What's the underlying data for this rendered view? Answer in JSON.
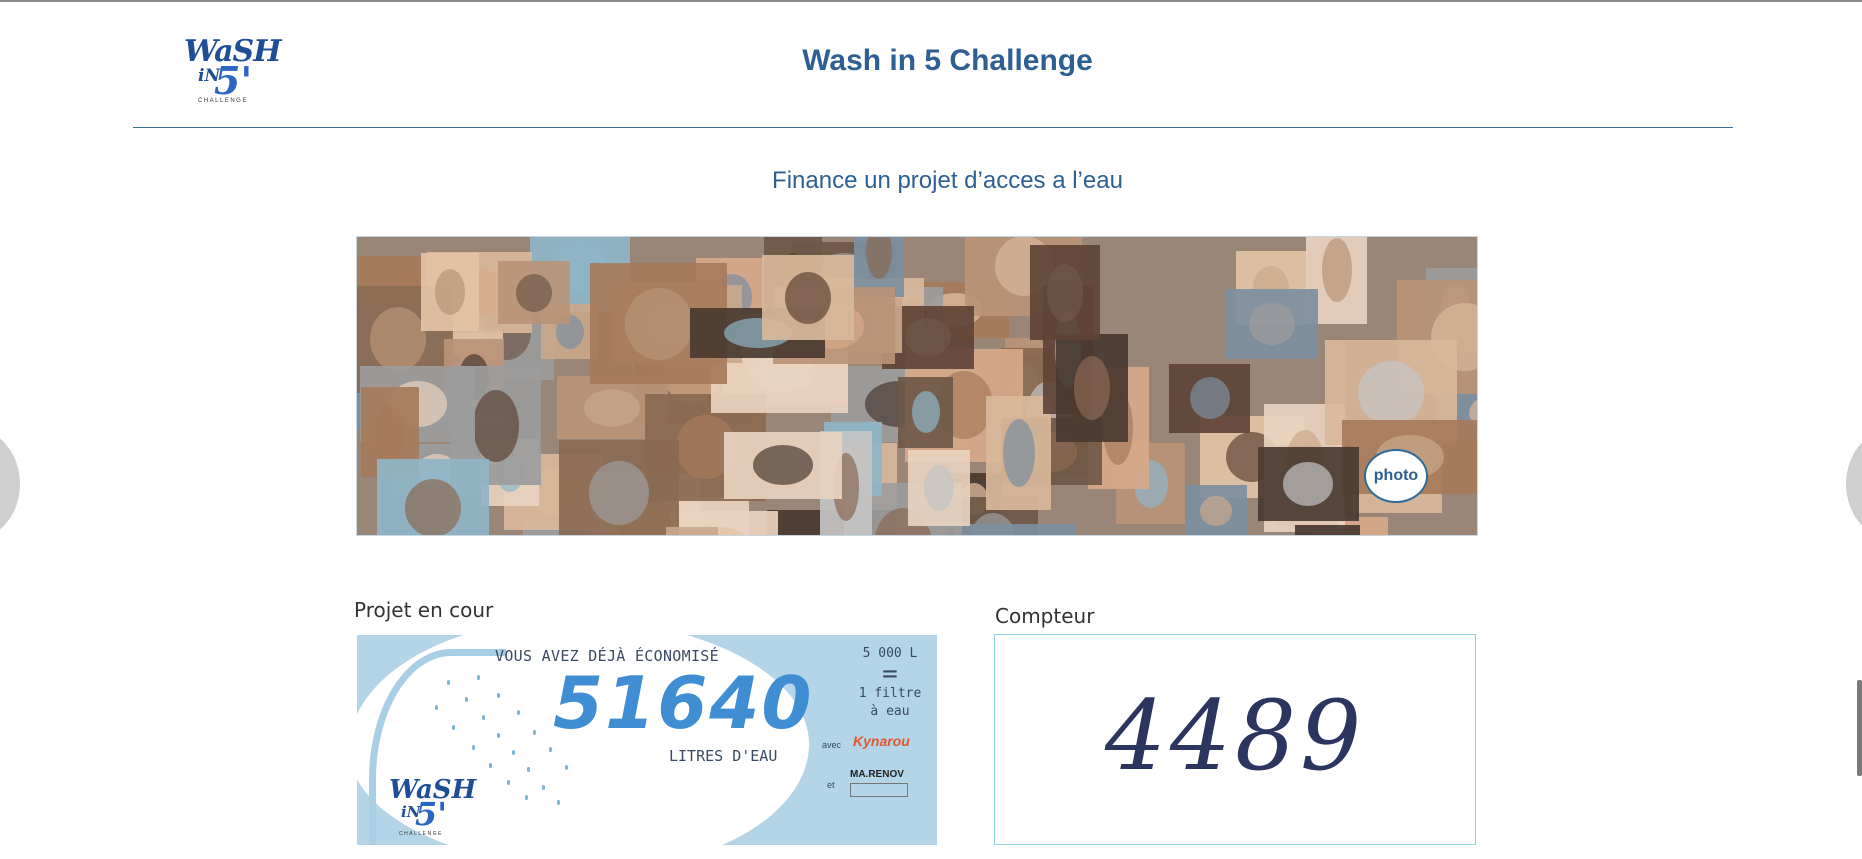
{
  "header": {
    "logo_text": "WASH IN 5' CHALLENGE",
    "title": "Wash in 5 Challenge"
  },
  "subtitle": "Finance un projet d’acces a l’eau",
  "slider": {
    "photo_button_label": "photo"
  },
  "project": {
    "label": "Projet en cour",
    "banner": {
      "line1": "VOUS AVEZ DÉJÀ ÉCONOMISÉ",
      "number": "51640",
      "line2": "LITRES D'EAU",
      "eq_top": "5 000 L",
      "eq_sign": "=",
      "eq_bottom1": "1 filtre",
      "eq_bottom2": "à eau",
      "avec": "avec",
      "partner1": "Kynarou",
      "et": "et",
      "partner2": "MA.RENOV"
    }
  },
  "counter": {
    "label": "Compteur",
    "value": "4489"
  },
  "colors": {
    "title_blue": "#2e5f92",
    "banner_bg": "#b4d5e8",
    "counter_border": "#8fd0e3"
  }
}
